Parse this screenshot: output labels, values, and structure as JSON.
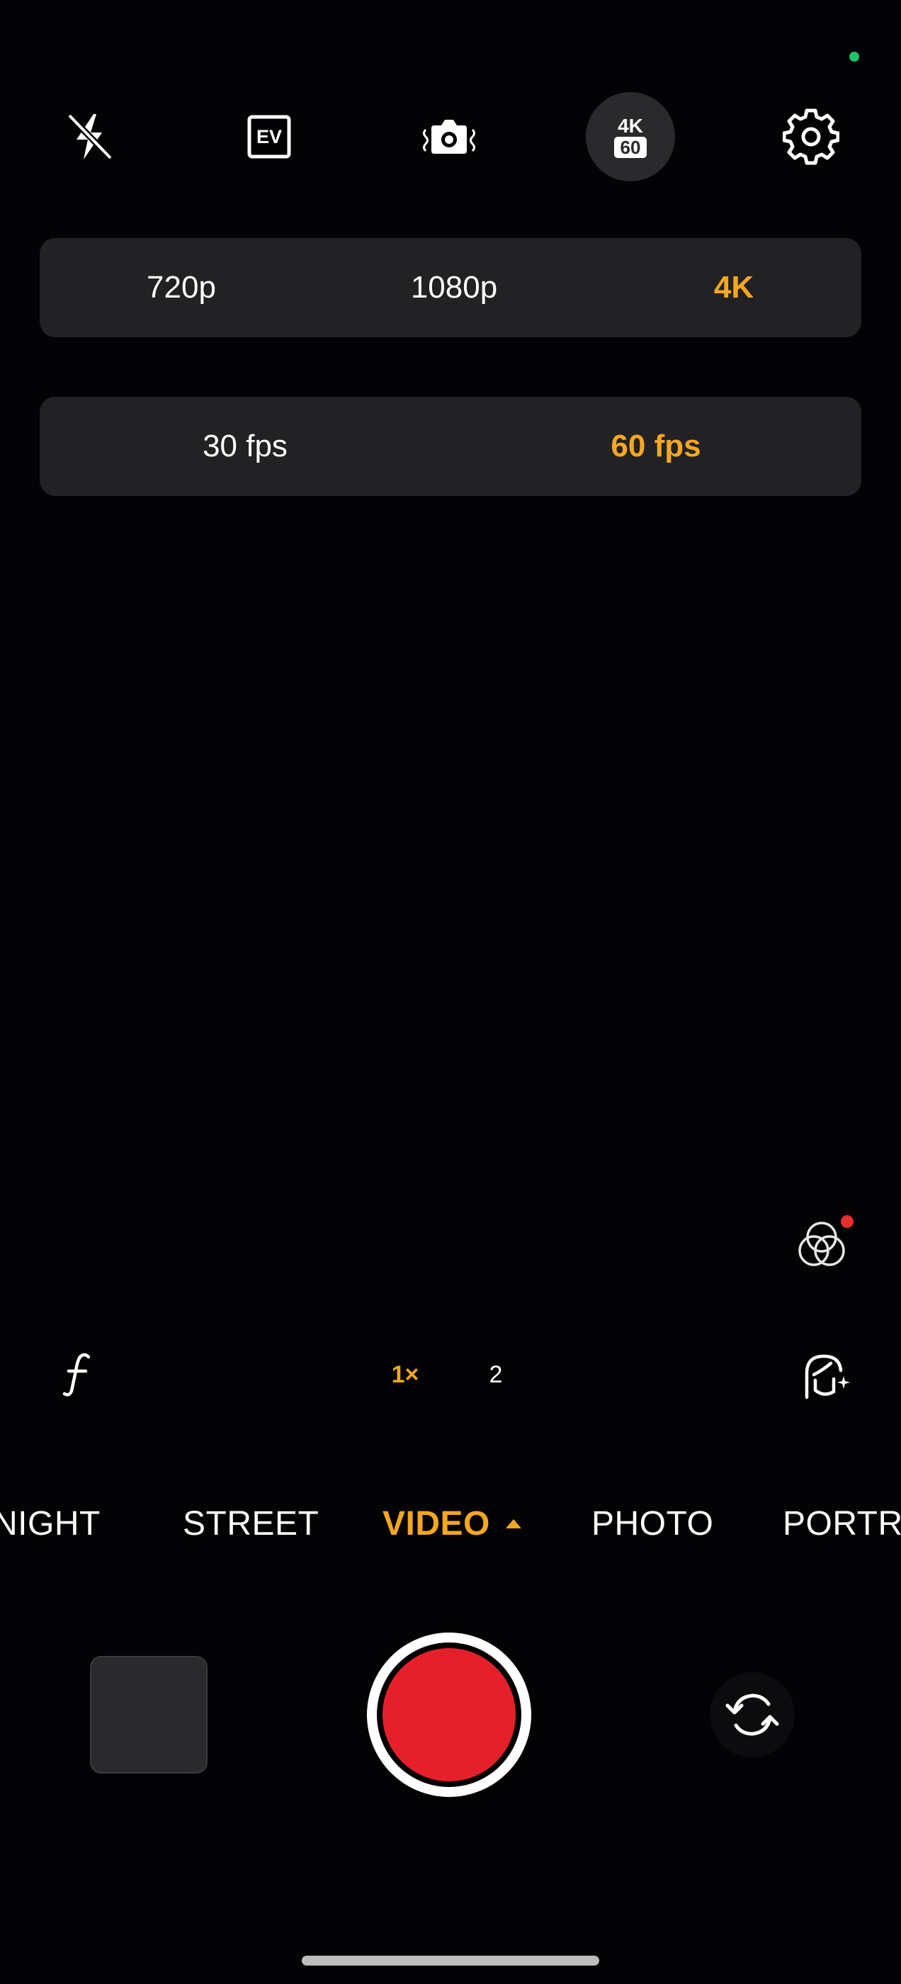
{
  "top_bar": {
    "items": [
      {
        "icon": "flash-off-icon"
      },
      {
        "icon": "ev-icon",
        "label": "EV"
      },
      {
        "icon": "stabilization-icon"
      },
      {
        "icon": "video-quality-icon",
        "line1": "4K",
        "line2": "60"
      },
      {
        "icon": "settings-gear-icon"
      }
    ]
  },
  "resolution": {
    "options": [
      "720p",
      "1080p",
      "4K"
    ],
    "selected": "4K"
  },
  "framerate": {
    "options": [
      "30 fps",
      "60 fps"
    ],
    "selected": "60 fps"
  },
  "lens": {
    "zoom_selected": "1×",
    "zoom_other": "2"
  },
  "modes": {
    "items": [
      "NIGHT",
      "STREET",
      "VIDEO",
      "PHOTO",
      "PORTRAIT"
    ],
    "selected": "VIDEO"
  },
  "colors": {
    "accent": "#f5a623",
    "record": "#e5202a",
    "panel": "#222224",
    "status_dot": "#1ec46b",
    "badge": "#e52e2e"
  }
}
